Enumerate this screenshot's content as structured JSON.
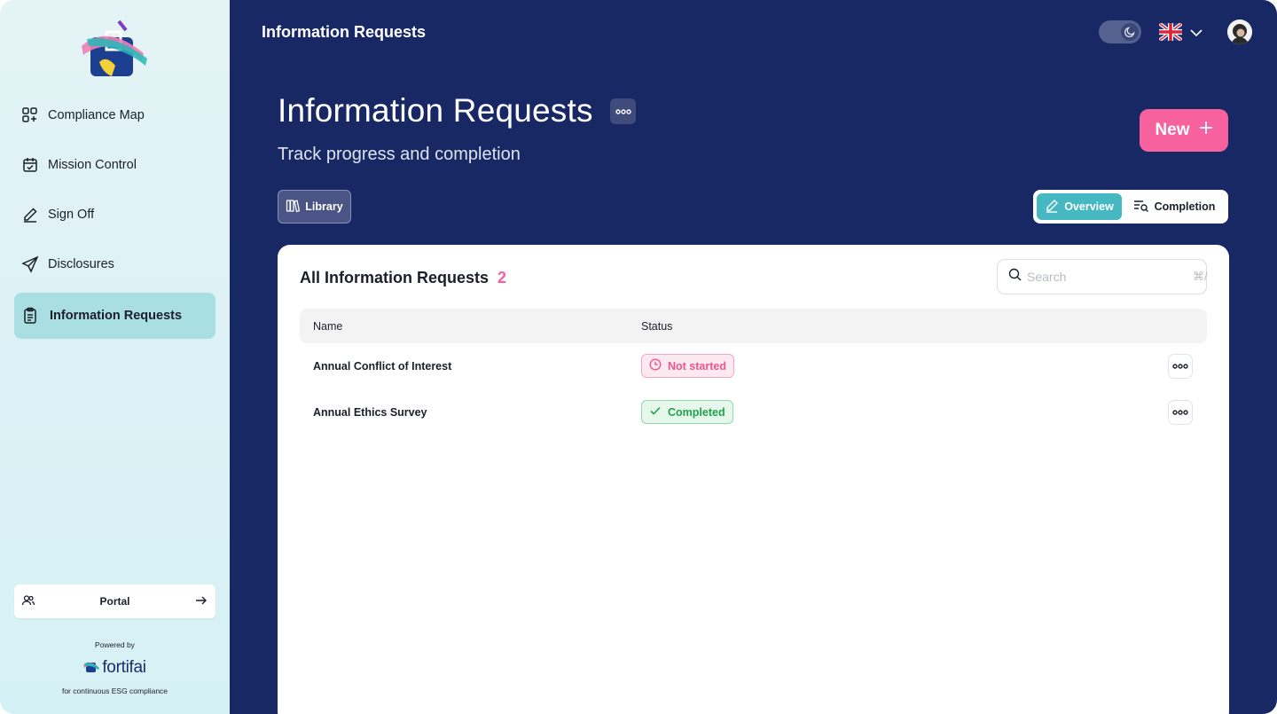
{
  "sidebar": {
    "items": [
      {
        "label": "Compliance Map",
        "icon": "grid-plus-icon",
        "active": false
      },
      {
        "label": "Mission Control",
        "icon": "calendar-check-icon",
        "active": false
      },
      {
        "label": "Sign Off",
        "icon": "pencil-icon",
        "active": false
      },
      {
        "label": "Disclosures",
        "icon": "send-icon",
        "active": false
      },
      {
        "label": "Information Requests",
        "icon": "clipboard-icon",
        "active": true
      }
    ],
    "portal_label": "Portal",
    "powered_by": "Powered by",
    "brand_name": "fortifai",
    "tagline": "for continuous ESG compliance"
  },
  "topbar": {
    "title": "Information Requests",
    "theme_toggle_icon": "moon-icon",
    "language_flag": "uk-flag-icon"
  },
  "page": {
    "title": "Information Requests",
    "subtitle": "Track progress and completion",
    "new_button": "New",
    "library_button": "Library",
    "view_tabs": [
      {
        "label": "Overview",
        "active": true
      },
      {
        "label": "Completion",
        "active": false
      }
    ]
  },
  "table": {
    "title": "All Information Requests",
    "count": "2",
    "search_placeholder": "Search",
    "search_shortcut": "⌘/",
    "columns": [
      "Name",
      "Status"
    ],
    "rows": [
      {
        "name": "Annual Conflict of Interest",
        "status": "Not started",
        "status_color": "#f05590"
      },
      {
        "name": "Annual Ethics Survey",
        "status": "Completed",
        "status_color": "#20a24b"
      }
    ]
  },
  "colors": {
    "main_bg": "#172864",
    "accent_pink": "#f7619e",
    "accent_teal": "#45b8c1",
    "sidebar_active": "#a9dfe3"
  }
}
